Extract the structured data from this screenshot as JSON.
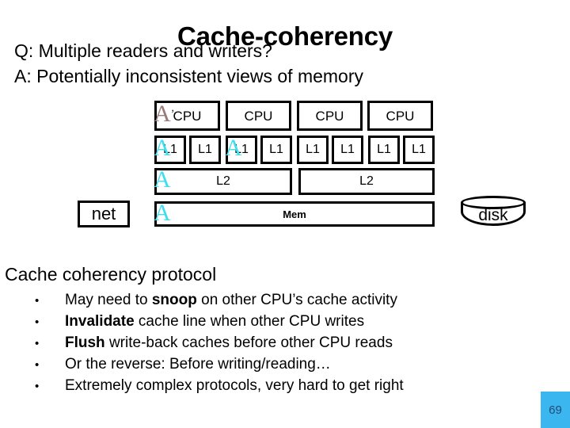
{
  "slide": {
    "title": "Cache-coherency",
    "question_line": "Q: Multiple readers and writers?",
    "answer_line": "A: Potentially inconsistent views of memory",
    "protocol_heading": "Cache coherency protocol",
    "page_number": "69"
  },
  "diagram": {
    "cpus": [
      "CPU",
      "CPU",
      "CPU",
      "CPU"
    ],
    "l1_caches": [
      "L1",
      "L1",
      "L1",
      "L1",
      "L1",
      "L1",
      "L1",
      "L1"
    ],
    "l2_caches": [
      "L2",
      "L2"
    ],
    "memory": "Mem",
    "net": "net",
    "disk": "disk",
    "stray_glyphs": [
      {
        "char": "A",
        "tick": "’",
        "color": "#9c7878"
      },
      {
        "char": "A",
        "color": "#3fdff0"
      },
      {
        "char": "A",
        "color": "#3fdff0"
      },
      {
        "char": "A",
        "color": "#3fdff0"
      },
      {
        "char": "A",
        "color": "#3fdff0"
      }
    ]
  },
  "bullets": [
    {
      "marker": "•",
      "prefix": "May need to ",
      "bold": "snoop",
      "suffix": " on other CPU’s cache activity"
    },
    {
      "marker": "•",
      "prefix": "",
      "bold": "Invalidate",
      "suffix": " cache line when other CPU writes"
    },
    {
      "marker": "•",
      "prefix": "",
      "bold": "Flush",
      "suffix": " write-back caches before other CPU reads"
    },
    {
      "marker": "•",
      "prefix": "Or the reverse: Before writing/reading…",
      "bold": "",
      "suffix": ""
    },
    {
      "marker": "•",
      "prefix": "Extremely complex protocols, very hard to get right",
      "bold": "",
      "suffix": ""
    }
  ],
  "colors": {
    "accent_cyan": "#3fdff0",
    "badge_blue": "#3cb6ef",
    "badge_text": "#1f4e79",
    "stray_mauve": "#9c7878"
  }
}
